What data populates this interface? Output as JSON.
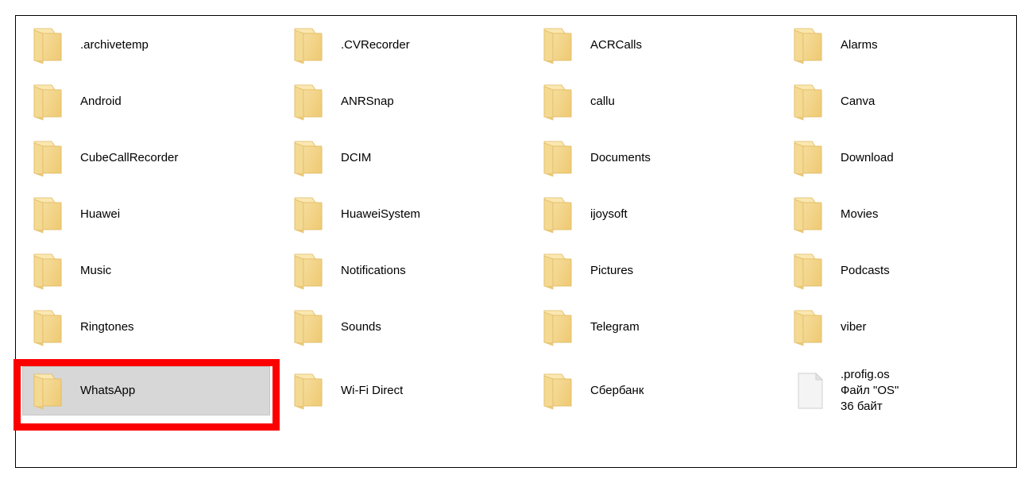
{
  "window": {
    "type": "file-explorer-content-pane",
    "view_mode": "tiles",
    "columns": 4,
    "rows": 8,
    "border_color": "#000000",
    "background": "#ffffff"
  },
  "selection": {
    "selected_item_name": "WhatsApp",
    "highlight_fill": "#d7d7d7",
    "highlight_border": "#c6c6c6",
    "annotation_color": "#fc0000"
  },
  "icons": {
    "folder": "folder-icon",
    "file": "file-icon",
    "folder_face": "#f2d082",
    "folder_back": "#fbe9b2",
    "folder_edge": "#e0b95f",
    "file_face": "#f4f4f4",
    "file_edge": "#cfcfcf"
  },
  "items": [
    {
      "name": ".archivetemp",
      "icon": "folder-icon",
      "col": 0,
      "row": 0,
      "selected": false
    },
    {
      "name": "Android",
      "icon": "folder-icon",
      "col": 0,
      "row": 1,
      "selected": false
    },
    {
      "name": "CubeCallRecorder",
      "icon": "folder-icon",
      "col": 0,
      "row": 2,
      "selected": false
    },
    {
      "name": "Huawei",
      "icon": "folder-icon",
      "col": 0,
      "row": 3,
      "selected": false
    },
    {
      "name": "Music",
      "icon": "folder-icon",
      "col": 0,
      "row": 4,
      "selected": false
    },
    {
      "name": "Ringtones",
      "icon": "folder-icon",
      "col": 0,
      "row": 5,
      "selected": false
    },
    {
      "name": "WhatsApp",
      "icon": "folder-icon",
      "col": 0,
      "row": 6,
      "selected": true
    },
    {
      "name": ".CVRecorder",
      "icon": "folder-icon",
      "col": 1,
      "row": 0,
      "selected": false
    },
    {
      "name": "ANRSnap",
      "icon": "folder-icon",
      "col": 1,
      "row": 1,
      "selected": false
    },
    {
      "name": "DCIM",
      "icon": "folder-icon",
      "col": 1,
      "row": 2,
      "selected": false
    },
    {
      "name": "HuaweiSystem",
      "icon": "folder-icon",
      "col": 1,
      "row": 3,
      "selected": false
    },
    {
      "name": "Notifications",
      "icon": "folder-icon",
      "col": 1,
      "row": 4,
      "selected": false
    },
    {
      "name": "Sounds",
      "icon": "folder-icon",
      "col": 1,
      "row": 5,
      "selected": false
    },
    {
      "name": "Wi-Fi Direct",
      "icon": "folder-icon",
      "col": 1,
      "row": 6,
      "selected": false
    },
    {
      "name": "ACRCalls",
      "icon": "folder-icon",
      "col": 2,
      "row": 0,
      "selected": false
    },
    {
      "name": "callu",
      "icon": "folder-icon",
      "col": 2,
      "row": 1,
      "selected": false
    },
    {
      "name": "Documents",
      "icon": "folder-icon",
      "col": 2,
      "row": 2,
      "selected": false
    },
    {
      "name": "ijoysoft",
      "icon": "folder-icon",
      "col": 2,
      "row": 3,
      "selected": false
    },
    {
      "name": "Pictures",
      "icon": "folder-icon",
      "col": 2,
      "row": 4,
      "selected": false
    },
    {
      "name": "Telegram",
      "icon": "folder-icon",
      "col": 2,
      "row": 5,
      "selected": false
    },
    {
      "name": "Сбербанк",
      "icon": "folder-icon",
      "col": 2,
      "row": 6,
      "selected": false
    },
    {
      "name": "Alarms",
      "icon": "folder-icon",
      "col": 3,
      "row": 0,
      "selected": false
    },
    {
      "name": "Canva",
      "icon": "folder-icon",
      "col": 3,
      "row": 1,
      "selected": false
    },
    {
      "name": "Download",
      "icon": "folder-icon",
      "col": 3,
      "row": 2,
      "selected": false
    },
    {
      "name": "Movies",
      "icon": "folder-icon",
      "col": 3,
      "row": 3,
      "selected": false
    },
    {
      "name": "Podcasts",
      "icon": "folder-icon",
      "col": 3,
      "row": 4,
      "selected": false
    },
    {
      "name": "viber",
      "icon": "folder-icon",
      "col": 3,
      "row": 5,
      "selected": false
    },
    {
      "name": ".profig.os",
      "icon": "file-icon",
      "col": 3,
      "row": 6,
      "selected": false,
      "meta": [
        "Файл \"OS\"",
        "36 байт"
      ]
    }
  ]
}
